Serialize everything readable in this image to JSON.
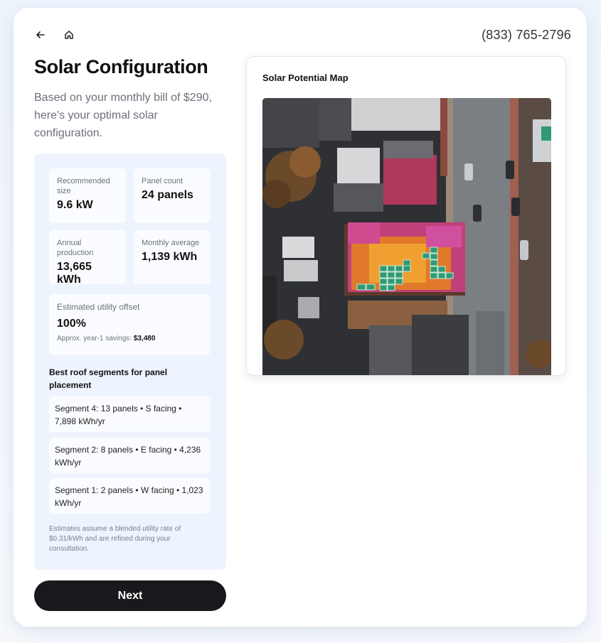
{
  "header": {
    "back_icon": "arrow-left-icon",
    "home_icon": "home-icon",
    "phone": "(833) 765-2796"
  },
  "page": {
    "title": "Solar Configuration",
    "subtitle": "Based on your monthly bill of $290, here's your optimal solar configuration."
  },
  "stats": {
    "recommended_size": {
      "label": "Recommended size",
      "value": "9.6 kW"
    },
    "panel_count": {
      "label": "Panel count",
      "value": "24 panels"
    },
    "annual_production": {
      "label": "Annual production",
      "value": "13,665 kWh"
    },
    "monthly_average": {
      "label": "Monthly average",
      "value": "1,139 kWh"
    }
  },
  "offset": {
    "label": "Estimated utility offset",
    "value": "100%",
    "savings_label": "Approx. year-1 savings:",
    "savings_value": "$3,480"
  },
  "segments": {
    "heading": "Best roof segments for panel placement",
    "items": [
      "Segment 4: 13 panels • S facing • 7,898 kWh/yr",
      "Segment 2: 8 panels • E facing • 4,236 kWh/yr",
      "Segment 1: 2 panels • W facing • 1,023 kWh/yr"
    ]
  },
  "footnote": "Estimates assume a blended utility rate of $0.31/kWh and are refined during your consultation.",
  "actions": {
    "next_label": "Next"
  },
  "map": {
    "title": "Solar Potential Map"
  },
  "colors": {
    "button_bg": "#18191c",
    "panel_bg": "#eef4fd",
    "heat_high": "#f0a030",
    "heat_low": "#d040a0",
    "solar_panel": "#2f9a74"
  }
}
